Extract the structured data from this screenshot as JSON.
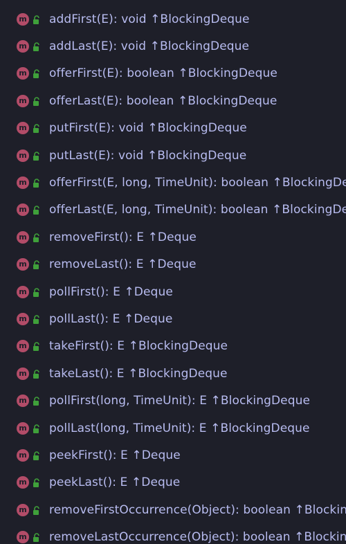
{
  "colors": {
    "background": "#1e1f29",
    "text": "#b8bcf0",
    "method_badge": "#b24c68",
    "lock_icon": "#3fa03a"
  },
  "icons": {
    "method_badge": "method-icon",
    "access": "public-lock-icon"
  },
  "members": [
    {
      "badge": "m",
      "text": "addFirst(E): void ↑BlockingDeque"
    },
    {
      "badge": "m",
      "text": "addLast(E): void ↑BlockingDeque"
    },
    {
      "badge": "m",
      "text": "offerFirst(E): boolean ↑BlockingDeque"
    },
    {
      "badge": "m",
      "text": "offerLast(E): boolean ↑BlockingDeque"
    },
    {
      "badge": "m",
      "text": "putFirst(E): void ↑BlockingDeque"
    },
    {
      "badge": "m",
      "text": "putLast(E): void ↑BlockingDeque"
    },
    {
      "badge": "m",
      "text": "offerFirst(E, long, TimeUnit): boolean ↑BlockingDeque"
    },
    {
      "badge": "m",
      "text": "offerLast(E, long, TimeUnit): boolean ↑BlockingDeque"
    },
    {
      "badge": "m",
      "text": "removeFirst(): E ↑Deque"
    },
    {
      "badge": "m",
      "text": "removeLast(): E ↑Deque"
    },
    {
      "badge": "m",
      "text": "pollFirst(): E ↑Deque"
    },
    {
      "badge": "m",
      "text": "pollLast(): E ↑Deque"
    },
    {
      "badge": "m",
      "text": "takeFirst(): E ↑BlockingDeque"
    },
    {
      "badge": "m",
      "text": "takeLast(): E ↑BlockingDeque"
    },
    {
      "badge": "m",
      "text": "pollFirst(long, TimeUnit): E ↑BlockingDeque"
    },
    {
      "badge": "m",
      "text": "pollLast(long, TimeUnit): E ↑BlockingDeque"
    },
    {
      "badge": "m",
      "text": "peekFirst(): E ↑Deque"
    },
    {
      "badge": "m",
      "text": "peekLast(): E ↑Deque"
    },
    {
      "badge": "m",
      "text": "removeFirstOccurrence(Object): boolean ↑BlockingDeque"
    },
    {
      "badge": "m",
      "text": "removeLastOccurrence(Object): boolean ↑BlockingDeque"
    }
  ]
}
